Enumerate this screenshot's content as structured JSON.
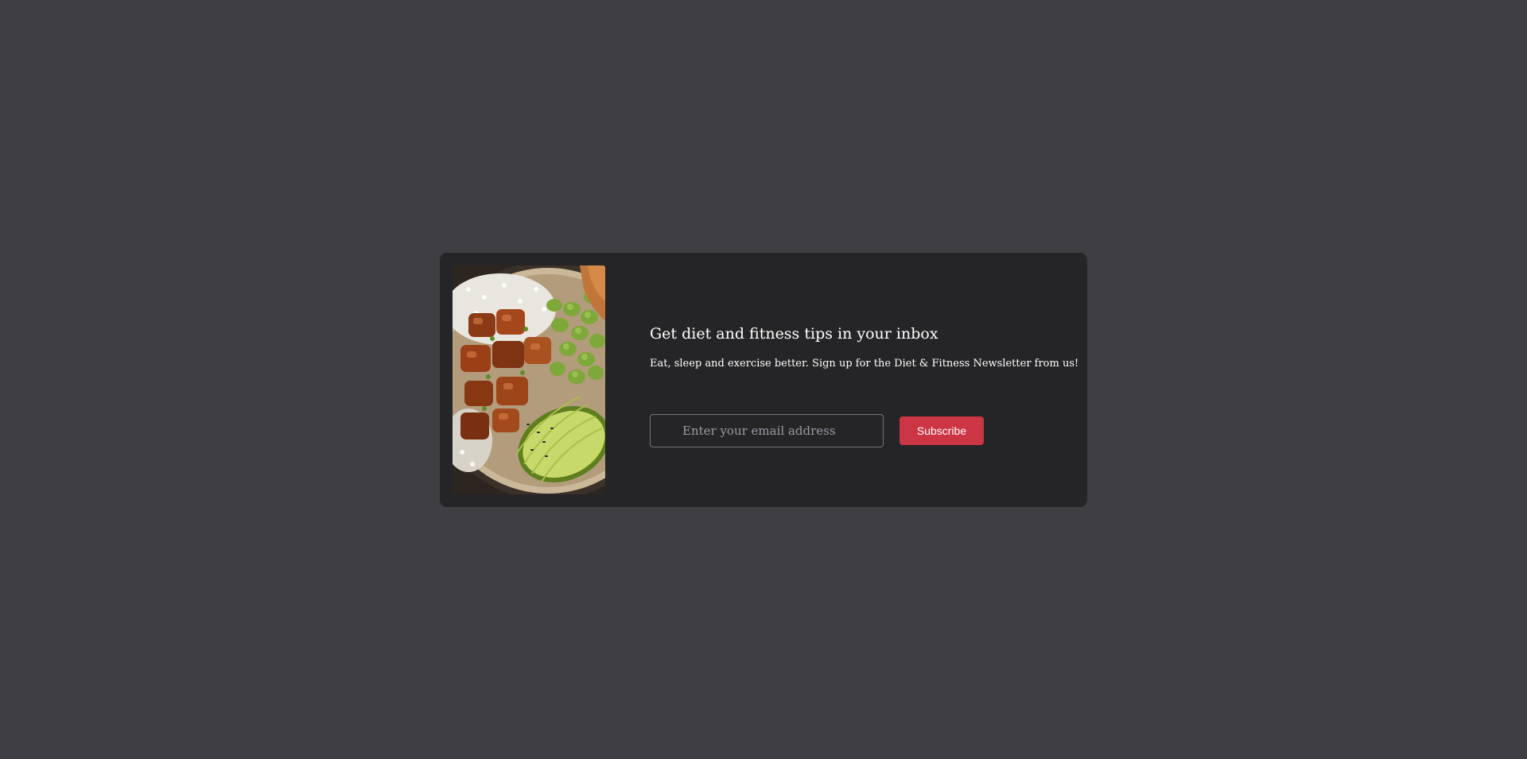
{
  "newsletter": {
    "title": "Get diet and fitness tips in your inbox",
    "description": "Eat, sleep and exercise better. Sign up for the Diet & Fitness Newsletter from us!",
    "email_placeholder": "Enter your email address",
    "email_value": "",
    "subscribe_label": "Subscribe",
    "image_subject": "poke-bowl-photo"
  },
  "colors": {
    "page_background": "#3e3e43",
    "card_background": "#252527",
    "accent": "#cb3544",
    "input_border": "#71757f",
    "text": "#ffffff"
  }
}
